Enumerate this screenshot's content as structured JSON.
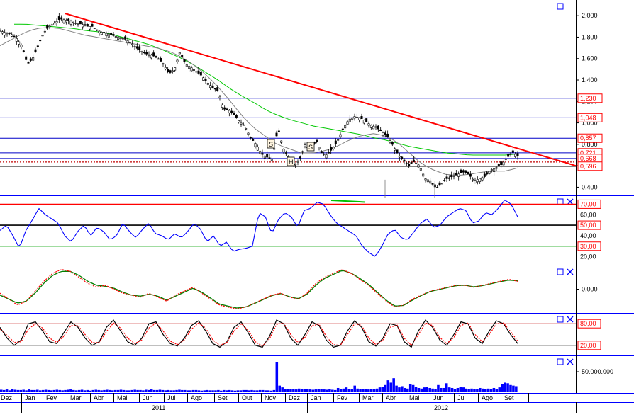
{
  "colors": {
    "price": "#000000",
    "ma_long": "#00c800",
    "ma_short": "#808080",
    "trendline": "#ff0000",
    "level_line": "#0000c8",
    "rsi": "#0000ff",
    "osc_fast": "#ff0000",
    "osc_slow": "#008000",
    "volume": "#0000ff",
    "label_box": "#ff0000",
    "axis_text": "#000000",
    "panel_border": "#0000ff"
  },
  "icons": {
    "panel_maximize": "maximize-icon",
    "panel_close": "close-icon"
  },
  "chart_data": [
    {
      "type": "candlestick",
      "panel": "price",
      "y_axis_ticks": [
        "2,000",
        "1,800",
        "1,600",
        "1,400",
        "1,200",
        "1,000",
        "0,800",
        "0,600",
        "0,400"
      ],
      "ylim": [
        0.35,
        2.12
      ],
      "series": [
        {
          "price_path": [
            1.86,
            1.84,
            1.83,
            1.79,
            1.72,
            1.55,
            1.6,
            1.72,
            1.84,
            1.9,
            1.93,
            1.97,
            1.96,
            1.95,
            1.93,
            1.92,
            1.9,
            1.9,
            1.86,
            1.84,
            1.83,
            1.81,
            1.8,
            1.78,
            1.75,
            1.7,
            1.67,
            1.64,
            1.63,
            1.6,
            1.55,
            1.46,
            1.5,
            1.66,
            1.55,
            1.52,
            1.48,
            1.44,
            1.38,
            1.33,
            1.3,
            1.13,
            1.12,
            1.07,
            1.01,
            0.96,
            0.86,
            0.8,
            0.71,
            0.68,
            0.66,
            0.95,
            0.76,
            0.68,
            0.6,
            0.66,
            0.8,
            0.74,
            0.84,
            0.72,
            0.7,
            0.76,
            0.84,
            0.95,
            1.03,
            1.06,
            1.05,
            1.02,
            0.98,
            0.96,
            0.92,
            0.88,
            0.8,
            0.71,
            0.65,
            0.6,
            0.64,
            0.6,
            0.48,
            0.46,
            0.39,
            0.43,
            0.48,
            0.5,
            0.52,
            0.54,
            0.52,
            0.46,
            0.48,
            0.5,
            0.56,
            0.58,
            0.61,
            0.67,
            0.73,
            0.69
          ]
        },
        {
          "name": "",
          "kind": "ma_long",
          "values": [
            1.92,
            1.92,
            1.91,
            1.9,
            1.89,
            1.88,
            1.86,
            1.85,
            1.83,
            1.8,
            1.77,
            1.74,
            1.7,
            1.65,
            1.6,
            1.54,
            1.47,
            1.4,
            1.32,
            1.25,
            1.19,
            1.12,
            1.07,
            1.03,
            1.0,
            0.97,
            0.95,
            0.93,
            0.91,
            0.89,
            0.86,
            0.84,
            0.81,
            0.78,
            0.76,
            0.74,
            0.72,
            0.71,
            0.7,
            0.7,
            0.7,
            0.7,
            0.71
          ]
        },
        {
          "name": "",
          "kind": "ma_short",
          "values": [
            1.72,
            1.78,
            1.84,
            1.88,
            1.89,
            1.88,
            1.85,
            1.82,
            1.8,
            1.78,
            1.76,
            1.74,
            1.72,
            1.7,
            1.67,
            1.62,
            1.55,
            1.46,
            1.35,
            1.22,
            1.08,
            0.96,
            0.88,
            0.8,
            0.76,
            0.72,
            0.72,
            0.74,
            0.78,
            0.84,
            0.88,
            0.9,
            0.88,
            0.82,
            0.72,
            0.62,
            0.56,
            0.52,
            0.51,
            0.52,
            0.54,
            0.55,
            0.55,
            0.58
          ]
        }
      ],
      "trendline": {
        "from": [
          0,
          2.02
        ],
        "to": [
          1,
          0.6
        ]
      },
      "horizontal_levels": [
        {
          "value": "1,230",
          "style": "blue"
        },
        {
          "value": "1,048",
          "style": "blue"
        },
        {
          "value": "0,857",
          "style": "blue"
        },
        {
          "value": "0,721",
          "style": "blue"
        },
        {
          "value": "0,668",
          "style": "blue"
        },
        {
          "value": "0,596",
          "style": "black"
        }
      ],
      "current_price_line": 0.635,
      "annotations": [
        "S",
        "H",
        "S"
      ]
    },
    {
      "type": "line",
      "panel": "rsi",
      "y_axis_ticks": [
        "70,00",
        "60,00",
        "50,00",
        "40,00",
        "30,00",
        "20,00"
      ],
      "highlighted_ticks": [
        "70,00",
        "50,00",
        "30,00"
      ],
      "ylim": [
        15,
        75
      ],
      "reference_lines": [
        70,
        50,
        30
      ],
      "series": [
        {
          "name": "",
          "values": [
            45,
            50,
            40,
            28,
            45,
            55,
            66,
            60,
            56,
            52,
            40,
            34,
            44,
            50,
            40,
            48,
            44,
            36,
            40,
            52,
            44,
            38,
            46,
            52,
            42,
            40,
            36,
            42,
            38,
            44,
            52,
            46,
            34,
            40,
            30,
            34,
            25,
            27,
            28,
            30,
            62,
            58,
            42,
            55,
            62,
            58,
            48,
            64,
            66,
            72,
            70,
            60,
            52,
            48,
            44,
            40,
            30,
            24,
            20,
            30,
            42,
            46,
            38,
            36,
            44,
            52,
            56,
            48,
            50,
            58,
            62,
            66,
            64,
            52,
            54,
            62,
            60,
            66,
            74,
            70,
            58
          ]
        }
      ]
    },
    {
      "type": "line",
      "panel": "oscillator",
      "y_axis_ticks": [
        "0,000"
      ],
      "series": [
        {
          "name": "",
          "kind": "fast",
          "values": [
            -0.2,
            -0.5,
            -0.8,
            -0.6,
            -0.1,
            0.4,
            0.8,
            1.0,
            0.9,
            0.6,
            0.3,
            0.1,
            0.2,
            0.0,
            -0.2,
            -0.3,
            -0.4,
            -0.2,
            -0.4,
            -0.6,
            -0.3,
            -0.1,
            0.1,
            -0.2,
            -0.5,
            -0.8,
            -0.9,
            -1.0,
            -0.9,
            -0.7,
            -0.5,
            -0.3,
            -0.2,
            -0.4,
            -0.5,
            -0.2,
            0.3,
            0.6,
            0.8,
            1.0,
            0.8,
            0.5,
            0.2,
            -0.2,
            -0.6,
            -0.9,
            -0.8,
            -0.5,
            -0.3,
            -0.1,
            0.0,
            0.1,
            0.2,
            0.2,
            0.1,
            0.2,
            0.3,
            0.4,
            0.5,
            0.4
          ]
        },
        {
          "name": "",
          "kind": "slow",
          "values": [
            -0.3,
            -0.5,
            -0.7,
            -0.6,
            -0.2,
            0.3,
            0.7,
            0.9,
            0.9,
            0.7,
            0.4,
            0.2,
            0.15,
            0.05,
            -0.15,
            -0.3,
            -0.35,
            -0.25,
            -0.35,
            -0.55,
            -0.35,
            -0.15,
            0.05,
            -0.15,
            -0.45,
            -0.75,
            -0.85,
            -0.95,
            -0.9,
            -0.72,
            -0.52,
            -0.32,
            -0.22,
            -0.38,
            -0.48,
            -0.25,
            0.2,
            0.55,
            0.75,
            0.95,
            0.82,
            0.55,
            0.25,
            -0.15,
            -0.55,
            -0.85,
            -0.82,
            -0.55,
            -0.32,
            -0.12,
            -0.02,
            0.08,
            0.18,
            0.2,
            0.12,
            0.18,
            0.28,
            0.38,
            0.46,
            0.42
          ]
        }
      ]
    },
    {
      "type": "line",
      "panel": "stochastic",
      "y_axis_ticks": [
        "80,00",
        "20,00"
      ],
      "highlighted_ticks": [
        "80,00",
        "20,00"
      ],
      "ylim": [
        0,
        100
      ],
      "reference_lines": [
        80,
        20
      ],
      "series": [
        {
          "name": "",
          "kind": "k",
          "values": [
            70,
            40,
            20,
            35,
            80,
            85,
            60,
            30,
            25,
            55,
            85,
            70,
            40,
            20,
            30,
            70,
            90,
            60,
            30,
            20,
            40,
            80,
            85,
            50,
            25,
            18,
            40,
            75,
            88,
            60,
            25,
            15,
            30,
            70,
            85,
            55,
            20,
            15,
            45,
            90,
            80,
            40,
            20,
            50,
            85,
            75,
            35,
            15,
            20,
            60,
            88,
            70,
            30,
            18,
            40,
            80,
            75,
            30,
            15,
            60,
            90,
            70,
            35,
            20,
            50,
            85,
            80,
            40,
            25,
            60,
            88,
            80,
            50,
            25
          ]
        },
        {
          "name": "",
          "kind": "d",
          "values": [
            65,
            48,
            28,
            30,
            65,
            80,
            68,
            40,
            28,
            45,
            75,
            75,
            50,
            28,
            28,
            58,
            82,
            68,
            40,
            25,
            35,
            68,
            82,
            60,
            32,
            22,
            35,
            65,
            82,
            68,
            35,
            20,
            28,
            60,
            80,
            62,
            30,
            18,
            38,
            78,
            82,
            50,
            28,
            42,
            75,
            78,
            45,
            22,
            20,
            50,
            80,
            75,
            40,
            22,
            35,
            70,
            76,
            40,
            20,
            50,
            82,
            75,
            42,
            25,
            42,
            75,
            82,
            50,
            30,
            50,
            80,
            82,
            58,
            32
          ]
        }
      ]
    },
    {
      "type": "bar",
      "panel": "volume",
      "y_axis_ticks": [
        "50.000.000"
      ],
      "ylim": [
        0,
        110
      ],
      "values": [
        6,
        5,
        7,
        4,
        8,
        6,
        5,
        5,
        6,
        4,
        7,
        5,
        5,
        6,
        4,
        5,
        6,
        5,
        4,
        5,
        6,
        5,
        4,
        5,
        6,
        7,
        5,
        4,
        5,
        6,
        4,
        5,
        3,
        5,
        6,
        5,
        4,
        5,
        6,
        5,
        4,
        5,
        5,
        6,
        5,
        4,
        4,
        5,
        6,
        5,
        5,
        4,
        6,
        5,
        7,
        5,
        5,
        6,
        5,
        4,
        5,
        4,
        4,
        5,
        6,
        5,
        5,
        4,
        4,
        5,
        5,
        4,
        3,
        4,
        5,
        4,
        4,
        4,
        5,
        3,
        5,
        4,
        5,
        4,
        3,
        4,
        4,
        5,
        5,
        4,
        5,
        4,
        4,
        5,
        5,
        4,
        4,
        3,
        5,
        100,
        20,
        14,
        9,
        8,
        9,
        8,
        7,
        10,
        8,
        9,
        8,
        7,
        6,
        7,
        8,
        9,
        7,
        6,
        8,
        6,
        5,
        12,
        9,
        10,
        14,
        8,
        9,
        20,
        10,
        9,
        8,
        9,
        7,
        8,
        9,
        10,
        14,
        16,
        22,
        38,
        30,
        45,
        20,
        14,
        18,
        12,
        10,
        24,
        22,
        16,
        12,
        10,
        14,
        16,
        12,
        10,
        8,
        22,
        12,
        12,
        28,
        14,
        12,
        9,
        12,
        16,
        14,
        10,
        9,
        10,
        8,
        9,
        12,
        10,
        9,
        10,
        8,
        12,
        9,
        14,
        24,
        30,
        28,
        22,
        20,
        18
      ]
    }
  ],
  "time_axis": {
    "months": [
      "Dez",
      "Jan",
      "Fev",
      "Mar",
      "Abr",
      "Mai",
      "Jun",
      "Jul",
      "Ago",
      "Set",
      "Out",
      "Nov",
      "Dez",
      "Jan",
      "Fev",
      "Mar",
      "Abr",
      "Mai",
      "Jun",
      "Jul",
      "Ago",
      "Set"
    ],
    "years": [
      "2011",
      "2012"
    ]
  }
}
